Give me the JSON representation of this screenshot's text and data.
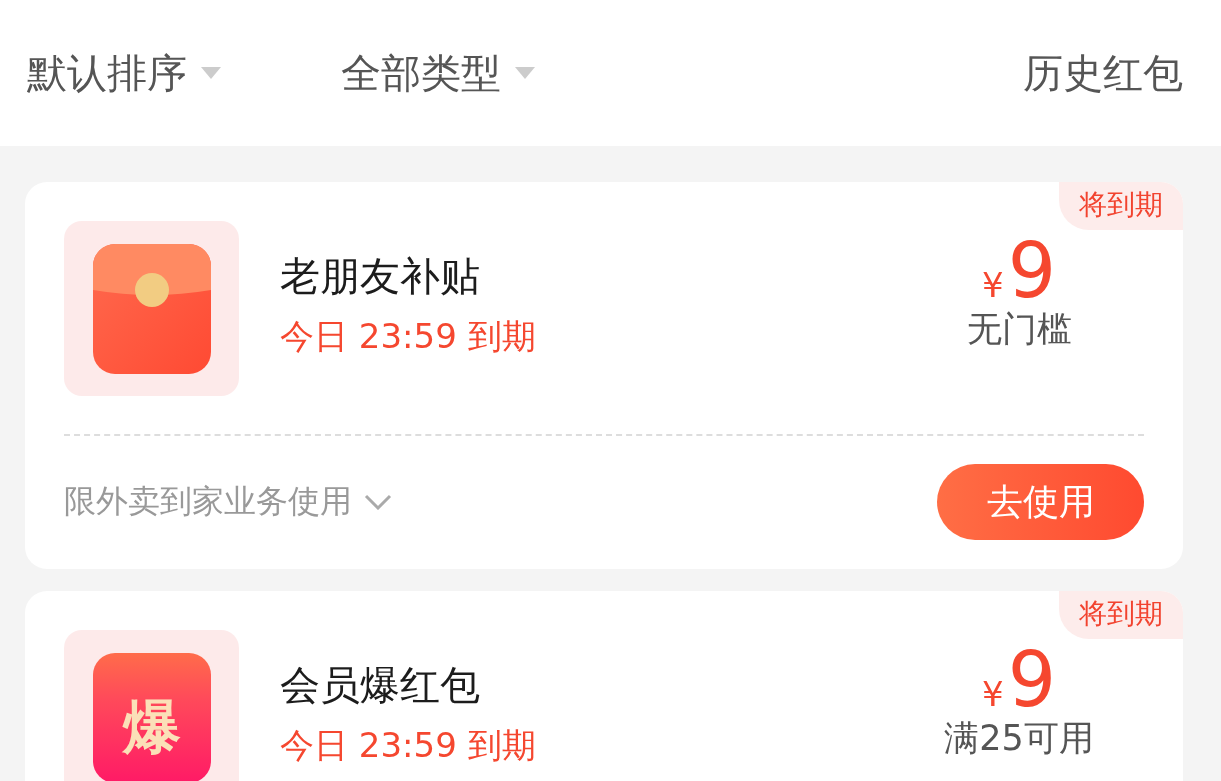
{
  "filters": [
    {
      "label": "默认排序",
      "kind": "dropdown"
    },
    {
      "label": "全部类型",
      "kind": "dropdown"
    },
    {
      "label": "历史红包",
      "kind": "link"
    }
  ],
  "coupons": [
    {
      "icon": {
        "kind": "envelope"
      },
      "title": "老朋友补贴",
      "expiry": "今日 23:59 到期",
      "badge": "将到期",
      "currency": "¥",
      "amount": "9",
      "condition": "无门槛",
      "scope": "限外卖到家业务使用",
      "action": "去使用"
    },
    {
      "icon": {
        "kind": "glyph",
        "text": "爆"
      },
      "title": "会员爆红包",
      "expiry": "今日 23:59 到期",
      "badge": "将到期",
      "currency": "¥",
      "amount": "9",
      "condition": "满25可用"
    }
  ]
}
